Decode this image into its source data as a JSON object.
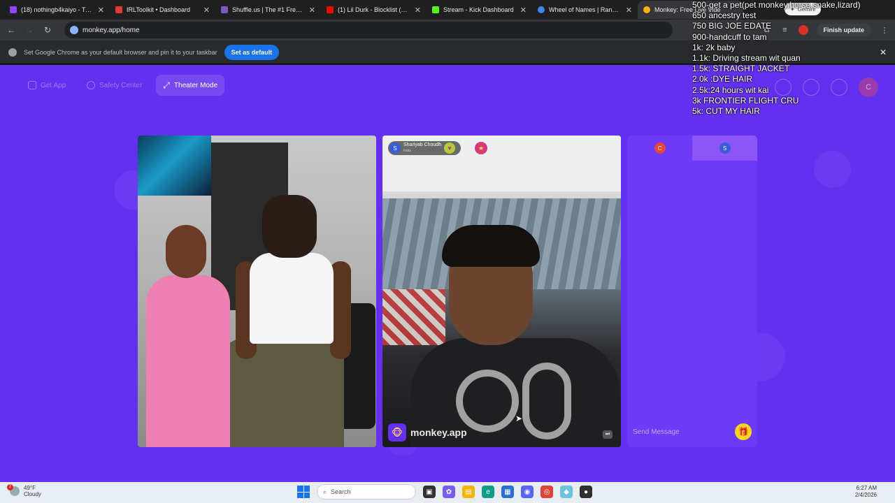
{
  "tabs": [
    {
      "title": "(18) nothingb4kaiyo - Twitch",
      "color": "#9146ff",
      "active": false
    },
    {
      "title": "IRLToolkit • Dashboard",
      "color": "#e53935",
      "active": false
    },
    {
      "title": "Shuffle.us | The #1 Free to Pl",
      "color": "#7e57c2",
      "active": false
    },
    {
      "title": "(1) Lil Durk - Blocklist (Officia",
      "color": "#ff0000",
      "active": false
    },
    {
      "title": "Stream - Kick Dashboard",
      "color": "#53fc18",
      "active": false
    },
    {
      "title": "Wheel of Names | Random n",
      "color": "#4285f4",
      "active": false
    },
    {
      "title": "Monkey: Free Live Vide",
      "color": "#ffb300",
      "active": true
    }
  ],
  "toolbar": {
    "url": "monkey.app/home",
    "gemini_label": "Gemini",
    "finish_update": "Finish update"
  },
  "infobar": {
    "message": "Set Google Chrome as your default browser and pin it to your taskbar",
    "button": "Set as default"
  },
  "page": {
    "nav": {
      "get_app": "Get App",
      "safety_center": "Safety Center",
      "theater_mode": "Theater Mode"
    },
    "avatar_letter": "C",
    "remote_user": {
      "initial": "S",
      "name": "Shariyab Choudh",
      "country": "India"
    },
    "brand": "monkey.app",
    "chat": {
      "left_avatar": "C",
      "right_avatar": "S",
      "placeholder": "Send Message"
    }
  },
  "overlay_lines": [
    "500-get a pet(pet monkey,horse,snake,lizard)",
    "650 ancestry test",
    "750 BIG JOE EDATE",
    "900-handcuff to tam",
    "1k: 2k baby",
    "1.1k: Driving stream wit quan",
    "1.5k: STRAIGHT JACKET",
    "2.0k :DYE HAIR",
    "2.5k:24 hours wit kai",
    "3k FRONTIER FLIGHT CRU",
    "5k: CUT MY HAIR"
  ],
  "taskbar": {
    "weather_temp": "49°F",
    "weather_desc": "Cloudy",
    "weather_badge": "2",
    "search_placeholder": "Search",
    "time": "6:27 AM",
    "date": "2/4/2026"
  },
  "colors": {
    "page_bg": "#6430f0",
    "chat_bg": "#6d3af5",
    "chat_tab_active": "#8b55f7",
    "avatar_c": "#e5483b",
    "avatar_s": "#3b5bdb"
  }
}
